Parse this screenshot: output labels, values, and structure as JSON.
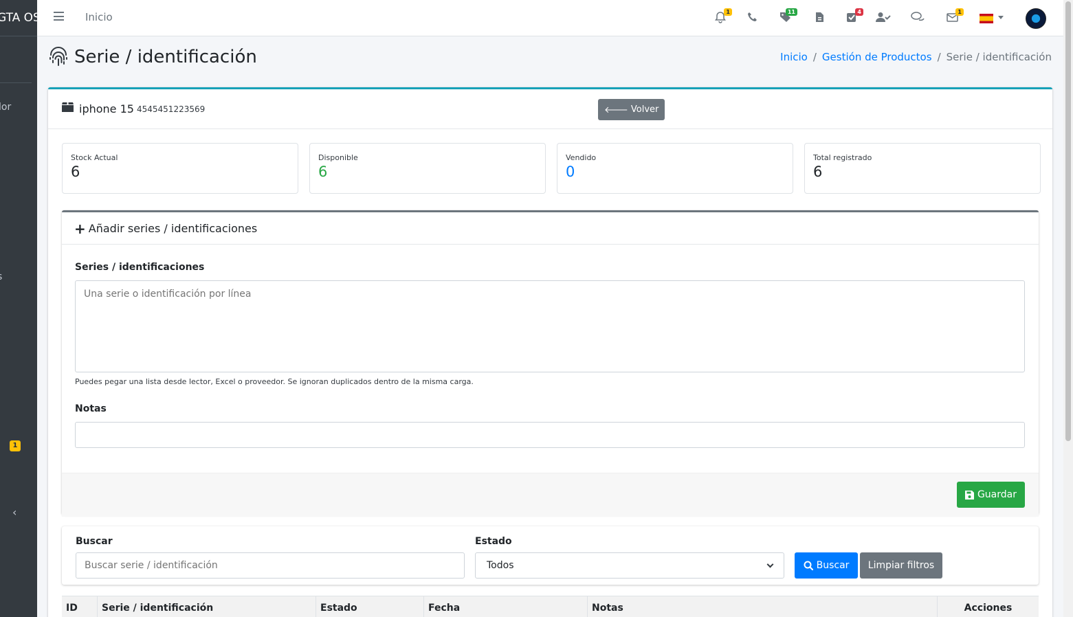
{
  "sidebar": {
    "brand": "GTA OS",
    "fragment_1": "lor",
    "fragment_2": "s",
    "badge": "1",
    "collapse_icon": "chevron-left-icon"
  },
  "navbar": {
    "home_label": "Inicio",
    "icons": [
      {
        "name": "bell-icon",
        "glyph": "🔔",
        "badge": "1",
        "badge_color": "#ffc107"
      },
      {
        "name": "phone-icon",
        "glyph": "✆",
        "badge": "",
        "badge_color": ""
      },
      {
        "name": "tags-icon",
        "glyph": "♥",
        "badge": "11",
        "badge_color": "#28a745"
      },
      {
        "name": "file-invoice-icon",
        "glyph": "▯",
        "badge": "",
        "badge_color": ""
      },
      {
        "name": "task-check-icon",
        "glyph": "☑",
        "badge": "4",
        "badge_color": "#dc3545"
      },
      {
        "name": "user-check-icon",
        "glyph": "👤",
        "badge": "",
        "badge_color": ""
      },
      {
        "name": "comments-icon",
        "glyph": "💬",
        "badge": "",
        "badge_color": ""
      },
      {
        "name": "envelope-icon",
        "glyph": "✉",
        "badge": "1",
        "badge_color": "#ffc107"
      }
    ],
    "language_flag": "flag-es-icon"
  },
  "header": {
    "title": "Serie / identificación",
    "icon": "fingerprint-icon",
    "breadcrumb": [
      "Inicio",
      "Gestión de Productos",
      "Serie / identificación"
    ]
  },
  "product": {
    "icon": "box-icon",
    "name": "iphone 15",
    "code": "4545451223569",
    "back_label": "Volver"
  },
  "stats": [
    {
      "label": "Stock Actual",
      "value": "6",
      "color": "#212529"
    },
    {
      "label": "Disponible",
      "value": "6",
      "color": "#28a745"
    },
    {
      "label": "Vendido",
      "value": "0",
      "color": "#007bff"
    },
    {
      "label": "Total registrado",
      "value": "6",
      "color": "#212529"
    }
  ],
  "add_form": {
    "title": "Añadir series / identificaciones",
    "series_label": "Series / identificaciones",
    "series_placeholder": "Una serie o identificación por línea",
    "help": "Puedes pegar una lista desde lector, Excel o proveedor. Se ignoran duplicados dentro de la misma carga.",
    "notes_label": "Notas",
    "notes_value": "",
    "save_label": "Guardar"
  },
  "filters": {
    "search_label": "Buscar",
    "search_placeholder": "Buscar serie / identificación",
    "status_label": "Estado",
    "status_selected": "Todos",
    "search_button": "Buscar",
    "clear_button": "Limpiar filtros"
  },
  "table": {
    "columns": [
      "ID",
      "Serie / identificación",
      "Estado",
      "Fecha",
      "Notas",
      "Acciones"
    ]
  }
}
